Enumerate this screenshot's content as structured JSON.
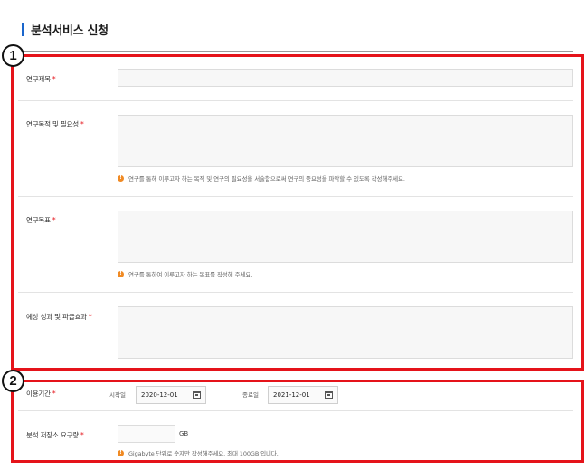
{
  "page": {
    "title": "분석서비스 신청"
  },
  "badges": {
    "one": "1",
    "two": "2"
  },
  "form": {
    "research_title": {
      "label": "연구제목",
      "required": "*"
    },
    "research_purpose": {
      "label": "연구목적 및 필요성",
      "required": "*",
      "hint": "연구를 통해 이루고자 하는 목적 및 연구의 필요성을 서술함으로써 연구의 중요성을 파악할 수 있도록 작성해주세요."
    },
    "research_goal": {
      "label": "연구목표",
      "required": "*",
      "hint": "연구를 통하여 이루고자 하는 목표를 작성해 주세요."
    },
    "expected_outcome": {
      "label": "예상 성과 및 파급효과",
      "required": "*"
    },
    "usage_period": {
      "label": "이용기간",
      "required": "*",
      "start_label": "시작일",
      "start_value": "2020-12-01",
      "end_label": "종료일",
      "end_value": "2021-12-01"
    },
    "storage": {
      "label": "분석 저장소 요구량",
      "required": "*",
      "unit": "GB",
      "hint": "Gigabyte 단위로 숫자만 작성해주세요. 최대 100GB 입니다."
    }
  },
  "colors": {
    "accent": "#1a66cc",
    "highlight_box": "#e5131a",
    "required": "#e5131a",
    "hint_icon": "#f08a24"
  },
  "icons": {
    "hint": "info-icon",
    "date": "calendar-icon"
  }
}
